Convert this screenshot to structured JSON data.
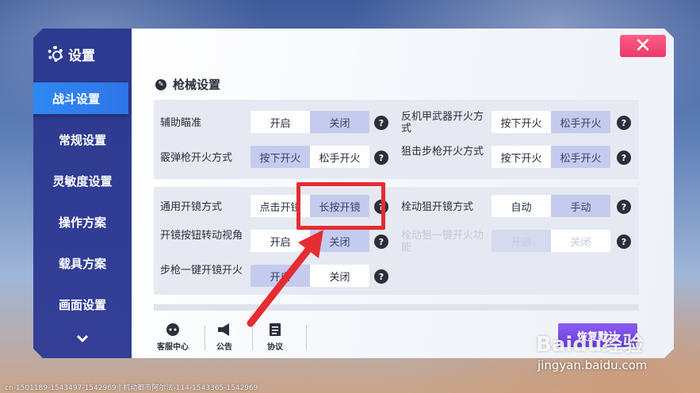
{
  "sidebar": {
    "title": "设置",
    "items": [
      {
        "label": "战斗设置",
        "active": true
      },
      {
        "label": "常规设置"
      },
      {
        "label": "灵敏度设置"
      },
      {
        "label": "操作方案"
      },
      {
        "label": "载具方案"
      },
      {
        "label": "画面设置"
      }
    ],
    "more_icon": "chevron-down-icon"
  },
  "header": {
    "close_label": "✕"
  },
  "section": {
    "title": "枪械设置",
    "icon": "pen-icon"
  },
  "group1": {
    "rows": [
      {
        "label": "辅助瞄准",
        "options": [
          "开启",
          "关闭"
        ],
        "selected": 0,
        "help": "?"
      },
      {
        "label": "反机甲武器开火方式",
        "options": [
          "按下开火",
          "松手开火"
        ],
        "selected": 0,
        "help": "?"
      },
      {
        "label": "霰弹枪开火方式",
        "options": [
          "按下开火",
          "松手开火"
        ],
        "selected": 1,
        "help": "?"
      },
      {
        "label": "狙击步枪开火方式",
        "options": [
          "按下开火",
          "松手开火"
        ],
        "selected": 0,
        "help": "?"
      }
    ]
  },
  "group2": {
    "rows": [
      {
        "label": "通用开镜方式",
        "options": [
          "点击开镜",
          "长按开镜"
        ],
        "selected": 0,
        "help": "?"
      },
      {
        "label": "栓动狙开镜方式",
        "options": [
          "自动",
          "手动"
        ],
        "selected": 0,
        "help": "?"
      },
      {
        "label": "开镜按钮转动视角",
        "options": [
          "开启",
          "关闭"
        ],
        "selected": 0,
        "help": "?"
      },
      {
        "label": "栓动狙一键开火功能",
        "options": [
          "开启",
          "关闭"
        ],
        "selected": 1,
        "disabled": true,
        "help": "?"
      },
      {
        "label": "步枪一键开镜开火",
        "options": [
          "开启",
          "关闭"
        ],
        "selected": 1,
        "help": "?"
      }
    ]
  },
  "footer": {
    "service_label": "客服中心",
    "notice_label": "公告",
    "agreement_label": "协议",
    "reset_label": "恢复默认"
  },
  "status_line": "cn-1501189-1543497-1542969 | 机动都市阿尔法-114-1543365-1542969",
  "watermark": {
    "logo": "Baidu经验",
    "url": "jingyan.baidu.com"
  },
  "colors": {
    "accent": "#2f74e8",
    "sidebar": "#2c3a8f",
    "close": "#e93a6a",
    "highlight": "#e42c33"
  }
}
